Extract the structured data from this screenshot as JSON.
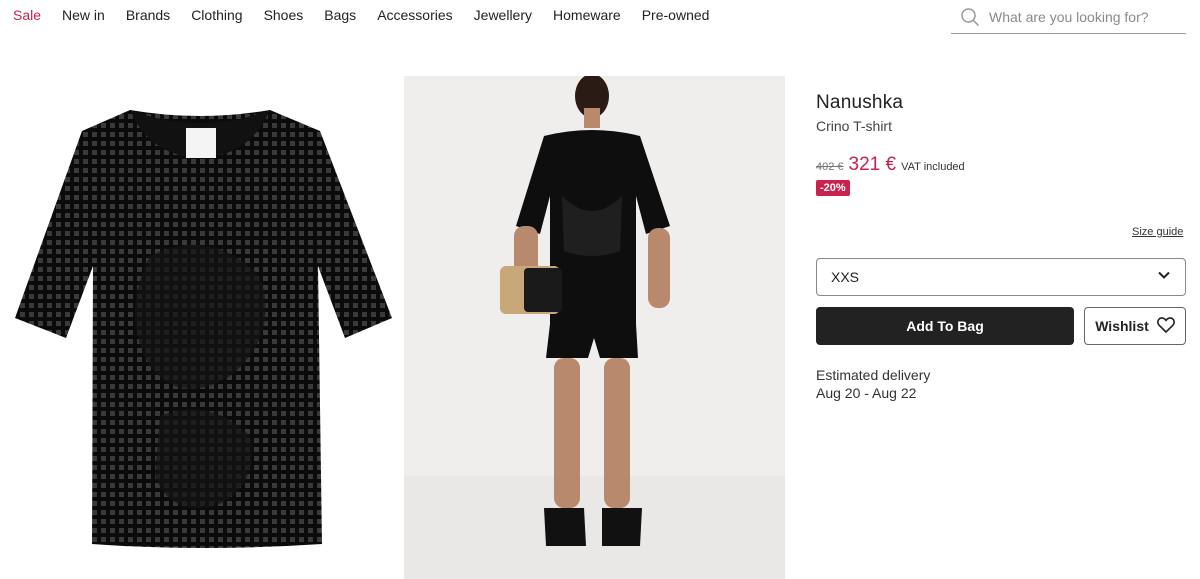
{
  "nav": {
    "items": [
      {
        "label": "Sale"
      },
      {
        "label": "New in"
      },
      {
        "label": "Brands"
      },
      {
        "label": "Clothing"
      },
      {
        "label": "Shoes"
      },
      {
        "label": "Bags"
      },
      {
        "label": "Accessories"
      },
      {
        "label": "Jewellery"
      },
      {
        "label": "Homeware"
      },
      {
        "label": "Pre-owned"
      }
    ]
  },
  "search": {
    "placeholder": "What are you looking for?",
    "icon": "search-icon"
  },
  "product": {
    "brand": "Nanushka",
    "name": "Crino T-shirt",
    "old_price": "402 €",
    "price": "321 €",
    "vat": "VAT included",
    "discount": "-20%",
    "size_guide": "Size guide",
    "selected_size": "XXS",
    "add_to_bag": "Add To Bag",
    "wishlist": "Wishlist",
    "delivery_label": "Estimated delivery",
    "delivery_dates": "Aug 20 - Aug 22"
  },
  "colors": {
    "accent": "#c8224d",
    "button_dark": "#222222"
  }
}
